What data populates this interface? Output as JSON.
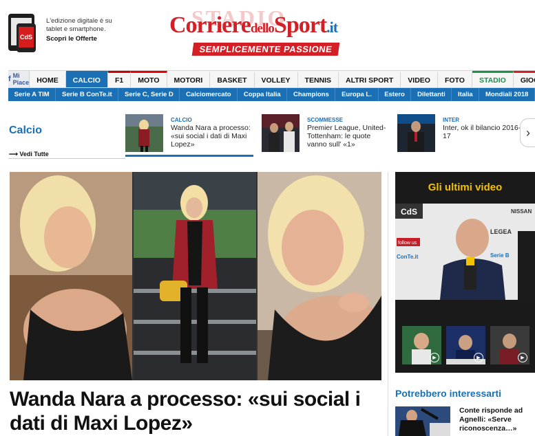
{
  "promo": {
    "text": "L'edizione digitale è su tablet e smartphone.",
    "link": "Scopri le Offerte",
    "device_badge": "CdS"
  },
  "logo": {
    "ghost": "STADIO",
    "main_a": "Corriere",
    "main_b": "dello",
    "main_c": "Sport",
    "main_d": ".it",
    "tagline": "SEMPLICEMENTE PASSIONE"
  },
  "nav": {
    "facebook": "Mi Piace",
    "items": [
      "HOME",
      "CALCIO",
      "F1",
      "MOTO",
      "MOTORI",
      "BASKET",
      "VOLLEY",
      "TENNIS",
      "ALTRI SPORT",
      "VIDEO",
      "FOTO",
      "STADIO",
      "GIOCHI"
    ],
    "active": "CALCIO"
  },
  "subnav": [
    "Serie A TIM",
    "Serie B ConTe.it",
    "Serie C, Serie D",
    "Calciomercato",
    "Coppa Italia",
    "Champions",
    "Europa L.",
    "Estero",
    "Dilettanti",
    "Italia",
    "Mondiali 2018"
  ],
  "section": {
    "title": "Calcio",
    "see_all": "Vedi Tutte"
  },
  "cards": [
    {
      "category": "CALCIO",
      "title": "Wanda Nara a processo: «sui social i dati di Maxi Lopez»"
    },
    {
      "category": "SCOMMESSE",
      "title": "Premier League, United-Tottenham: le quote vanno sull' «1»"
    },
    {
      "category": "INTER",
      "title": "Inter, ok il bilancio 2016-17"
    }
  ],
  "headline": "Wanda Nara a processo: «sui social i dati di Maxi Lopez»",
  "videos": {
    "title": "Gli ultimi video",
    "banner_labels": [
      "CdS",
      "follow us",
      "LEGEA",
      "Serie B",
      "ConTe.it",
      "NISSAN"
    ]
  },
  "recs": {
    "title": "Potrebbero interessarti",
    "item_title": "Conte risponde ad Agnelli: «Serve riconoscenza…»"
  },
  "colors": {
    "brand_red": "#d31f26",
    "brand_blue": "#1a6fb5",
    "video_title": "#f2c200"
  }
}
